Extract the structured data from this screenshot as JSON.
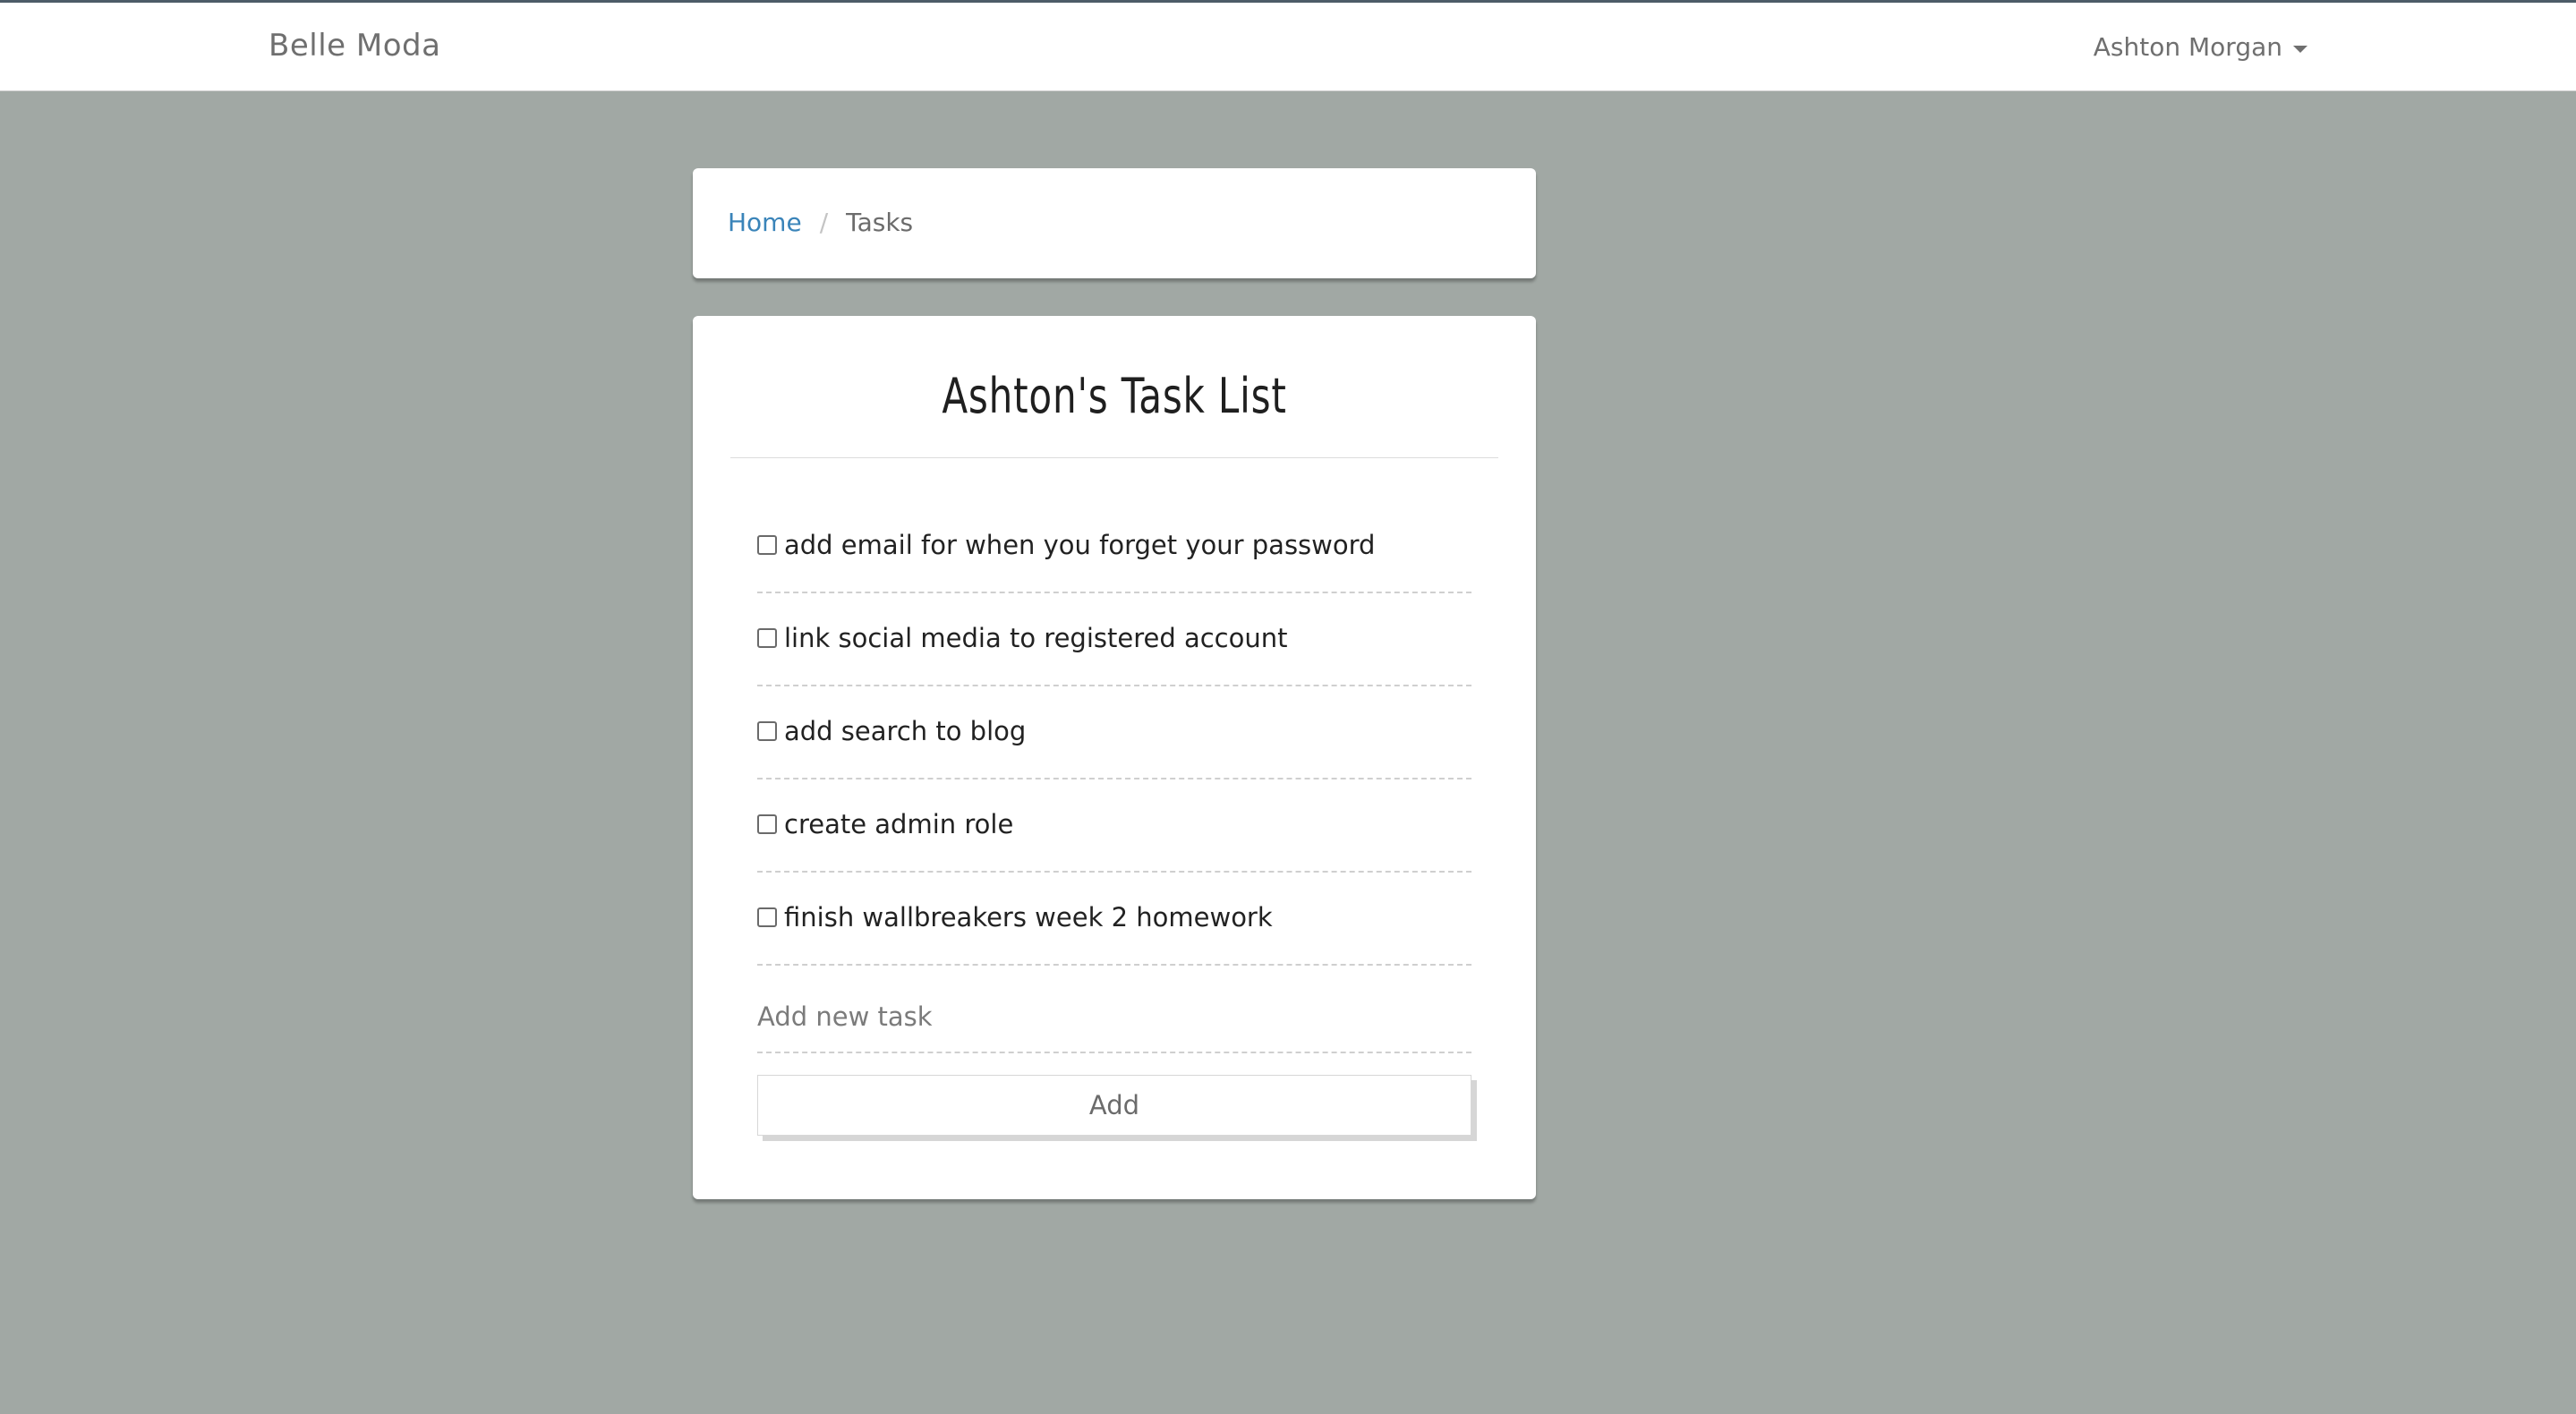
{
  "navbar": {
    "brand": "Belle Moda",
    "user_name": "Ashton Morgan"
  },
  "breadcrumb": {
    "home": "Home",
    "separator": "/",
    "current": "Tasks"
  },
  "task_list": {
    "title": "Ashton's Task List",
    "tasks": [
      {
        "label": "add email for when you forget your password",
        "checked": false
      },
      {
        "label": "link social media to registered account",
        "checked": false
      },
      {
        "label": "add search to blog",
        "checked": false
      },
      {
        "label": "create admin role",
        "checked": false
      },
      {
        "label": "finish wallbreakers week 2 homework",
        "checked": false
      }
    ],
    "new_task_placeholder": "Add new task",
    "new_task_value": "",
    "add_button_label": "Add"
  },
  "colors": {
    "page_background": "#a1a8a4",
    "link": "#3a84b9",
    "top_border": "#4d5c68"
  }
}
